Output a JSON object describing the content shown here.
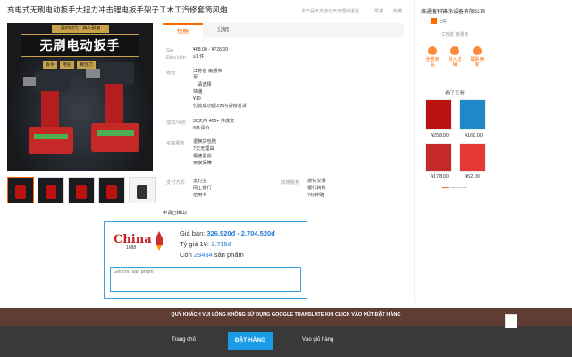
{
  "product": {
    "title": "充电式无刷电动扳手大扭力冲击锂电扳手架子工木工汽修套筒风炮",
    "top_note": "本产品不支持七天无理由退货",
    "top_actions": [
      "举报",
      "收藏"
    ]
  },
  "main_image": {
    "banner_sub": "强劲动力 · 持久耐用",
    "banner": "无刷电动扳手",
    "chips": [
      "扳手",
      "电钻",
      "螺丝刀"
    ]
  },
  "tabs": [
    {
      "label": "规格",
      "active": true
    },
    {
      "label": "分销",
      "active": false
    }
  ],
  "specs": {
    "price_label": "Giá",
    "price_value": "¥68.00 - ¥728.00",
    "moq_label": "Điều kiện",
    "moq_value": "≥1 件",
    "shipping_label": "物流",
    "shipping_lines": [
      "江苏省 南通市",
      "至",
      "请选择",
      "快递",
      "¥10",
      "付款成功后3天内货物发货"
    ],
    "rating_label": "成交/评价",
    "rating_lines": [
      "30天内 400+ 件成交",
      "8条评价"
    ],
    "service_label": "买家服务",
    "service_lines": [
      "退换货包赔",
      "7天无理由",
      "极速退款",
      "买家保障"
    ],
    "payment_label": "支付方式",
    "payment_lines": [
      "支付宝",
      "网上银行",
      "信用卡"
    ],
    "cross_label": "跨境服务",
    "cross_lines": [
      "按体交易",
      "银行转账",
      "7分钟赔"
    ],
    "note": "申请已推出!"
  },
  "pricebox": {
    "logo_text": "China",
    "logo_num": "1688",
    "price_label": "Giá bán:",
    "price_value": "326.920đ - 2.704.520đ",
    "rate_label": "Tỷ giá 1¥:",
    "rate_value": "3.715đ",
    "stock_label": "Còn",
    "stock_value": "28434",
    "stock_suffix": "sản phẩm",
    "notes_placeholder": "Ghi chú sản phẩm"
  },
  "shop": {
    "name": "南通蓄科锋涂设备有限公司",
    "years": "3年",
    "location": "江苏省 南通市",
    "actions": [
      "全部商品",
      "进入店铺",
      "联系卖家"
    ],
    "viewed_title": "看了又看",
    "items": [
      {
        "price": "¥258.00"
      },
      {
        "price": "¥168.00"
      },
      {
        "price": "¥178.00"
      },
      {
        "price": "¥52.00"
      }
    ]
  },
  "bottom": {
    "warning": "QUÝ KHÁCH VUI LÒNG KHÔNG SỬ DỤNG GOOGLE TRANSLATE KHI CLICK VÀO NÚT ĐẶT HÀNG",
    "home_label": "Trang chủ",
    "order_label": "ĐẶT HÀNG",
    "cart_label": "Vào giỏ hàng"
  },
  "colors": {
    "accent": "#ff6a00",
    "link": "#1f7ad6",
    "order_button": "#1a9be6"
  }
}
